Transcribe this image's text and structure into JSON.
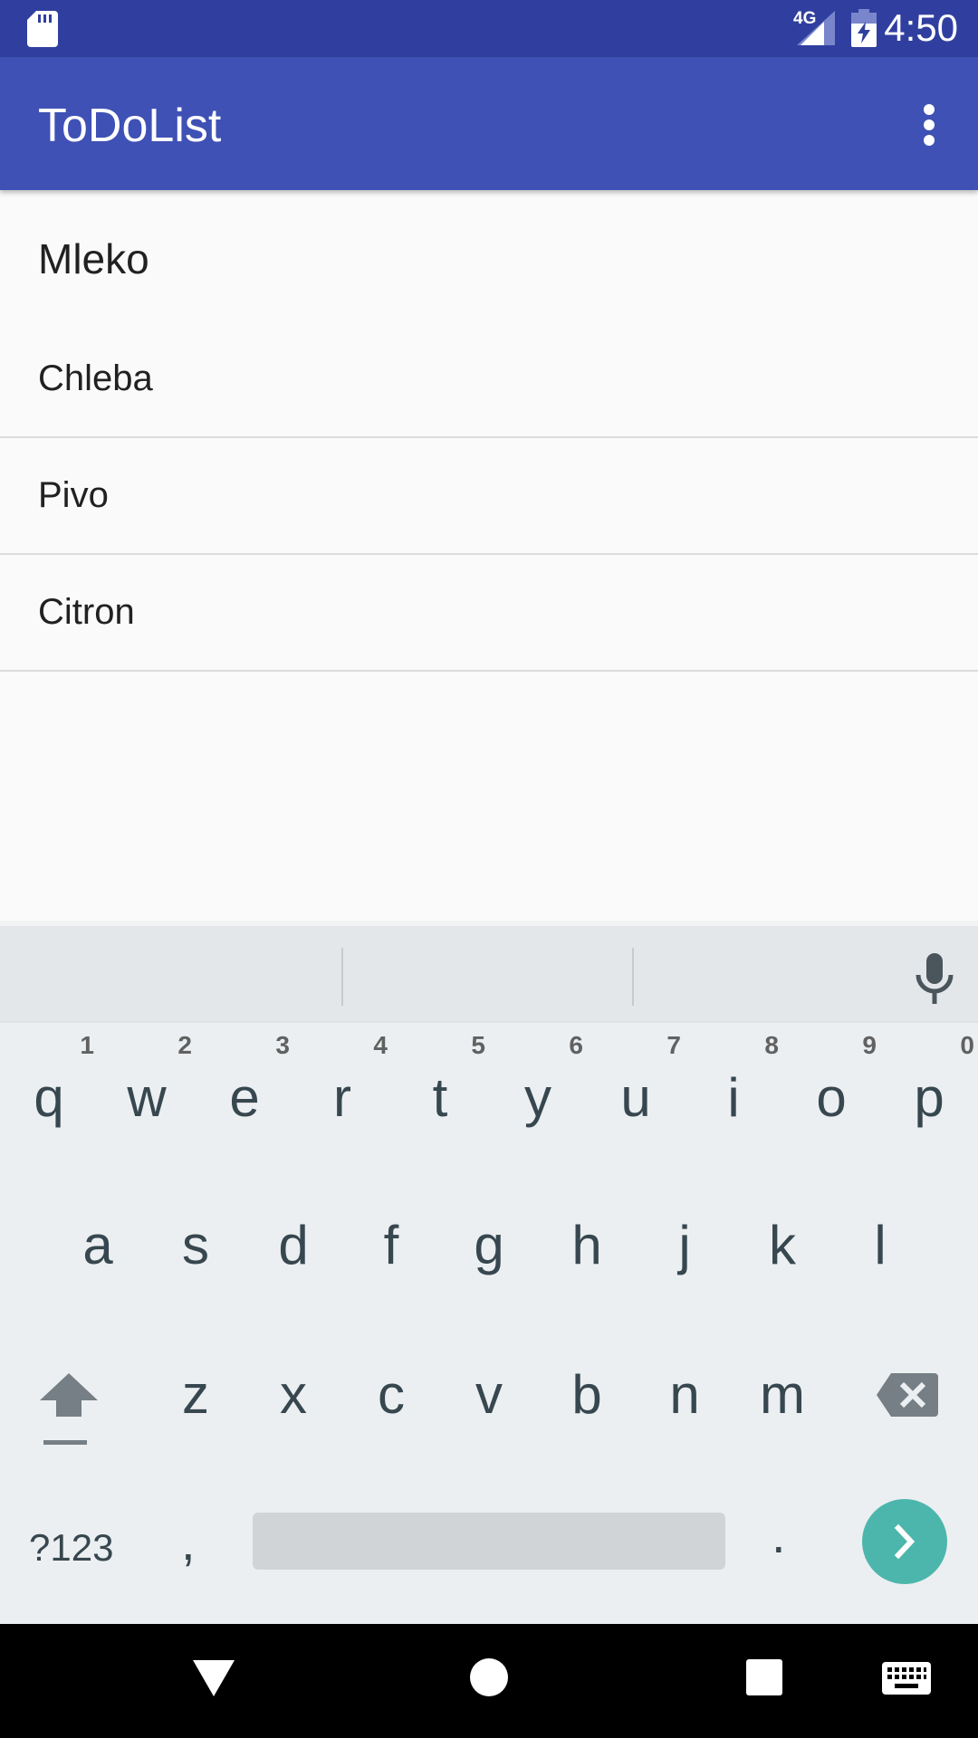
{
  "status_bar": {
    "network": "4G",
    "time": "4:50",
    "icons": [
      "sd-card-icon",
      "signal-icon",
      "battery-charging-icon"
    ]
  },
  "app_bar": {
    "title": "ToDoList",
    "overflow_icon": "more-vert-icon"
  },
  "input": {
    "value": "Mleko"
  },
  "todo_items": [
    "Chleba",
    "Pivo",
    "Citron"
  ],
  "keyboard": {
    "row1": [
      {
        "letter": "q",
        "hint": "1"
      },
      {
        "letter": "w",
        "hint": "2"
      },
      {
        "letter": "e",
        "hint": "3"
      },
      {
        "letter": "r",
        "hint": "4"
      },
      {
        "letter": "t",
        "hint": "5"
      },
      {
        "letter": "y",
        "hint": "6"
      },
      {
        "letter": "u",
        "hint": "7"
      },
      {
        "letter": "i",
        "hint": "8"
      },
      {
        "letter": "o",
        "hint": "9"
      },
      {
        "letter": "p",
        "hint": "0"
      }
    ],
    "row2": [
      "a",
      "s",
      "d",
      "f",
      "g",
      "h",
      "j",
      "k",
      "l"
    ],
    "row3": [
      "z",
      "x",
      "c",
      "v",
      "b",
      "n",
      "m"
    ],
    "symbols_label": "?123",
    "comma_label": ",",
    "period_label": ".",
    "icons": [
      "mic-icon",
      "shift-icon",
      "backspace-icon",
      "enter-arrow-icon"
    ]
  },
  "nav_bar": {
    "icons": [
      "back-icon",
      "home-icon",
      "recents-icon",
      "keyboard-switch-icon"
    ]
  },
  "colors": {
    "status_bar": "#303f9f",
    "app_bar": "#3f51b5",
    "enter_key": "#4db6ac",
    "keyboard_bg": "#eceff1"
  }
}
